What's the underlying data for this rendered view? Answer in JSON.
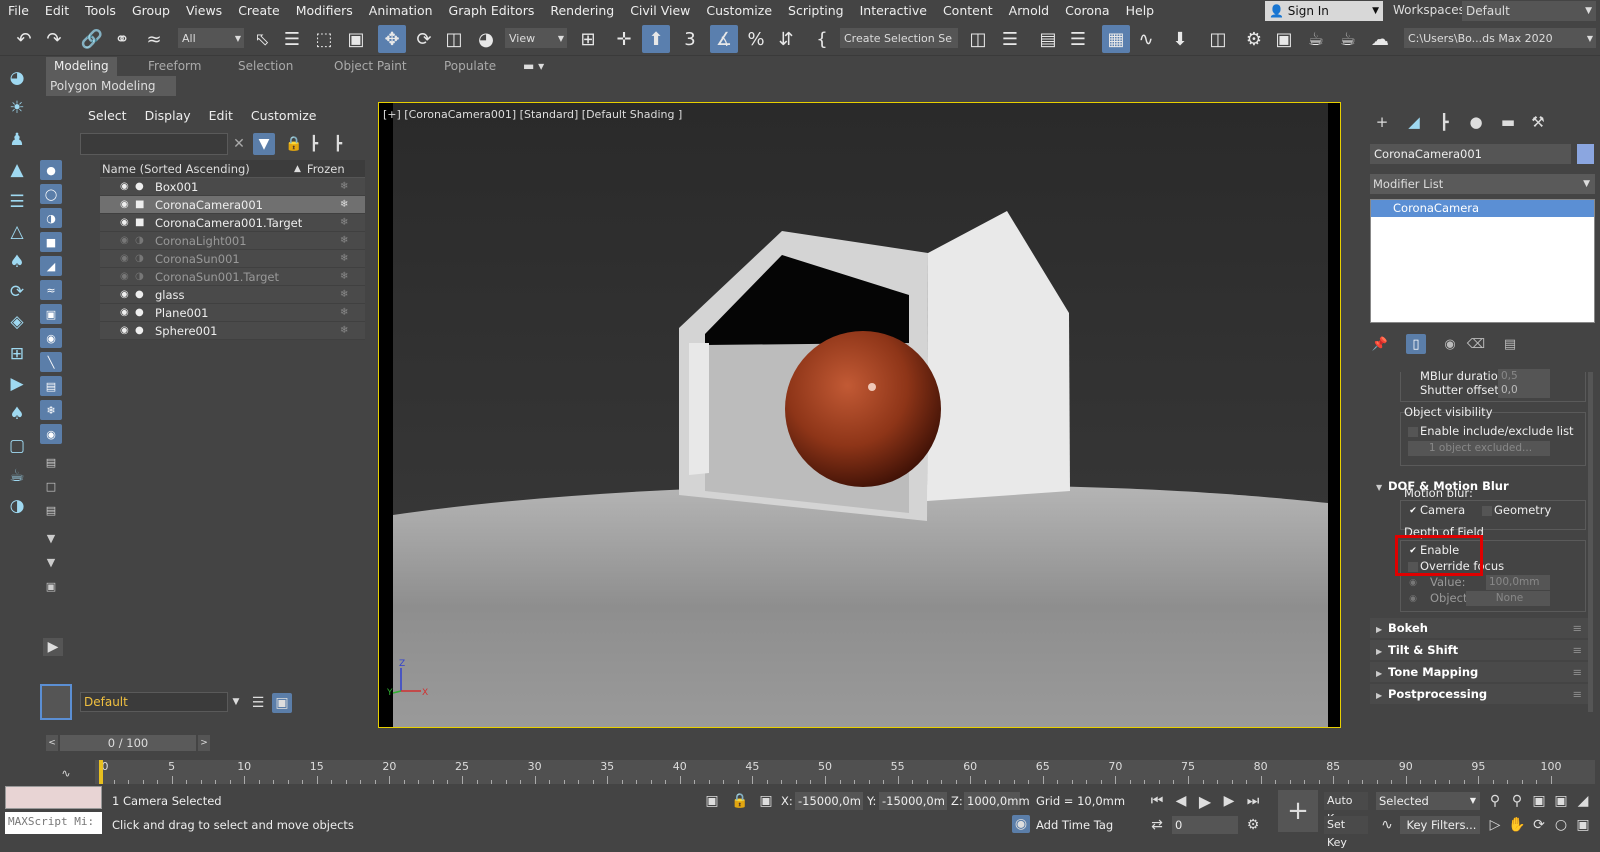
{
  "menubar": {
    "items": [
      "File",
      "Edit",
      "Tools",
      "Group",
      "Views",
      "Create",
      "Modifiers",
      "Animation",
      "Graph Editors",
      "Rendering",
      "Civil View",
      "Customize",
      "Scripting",
      "Interactive",
      "Content",
      "Arnold",
      "Corona",
      "Help"
    ],
    "signin": "Sign In",
    "workspaces_label": "Workspaces:",
    "workspace": "Default"
  },
  "toolbar": {
    "filter": "All",
    "ref_coord": "View",
    "selection_set": "Create Selection Se",
    "project_path": "C:\\Users\\Bo...ds Max 2020"
  },
  "ribbon": {
    "tabs": [
      "Modeling",
      "Freeform",
      "Selection",
      "Object Paint",
      "Populate"
    ],
    "subtab": "Polygon Modeling"
  },
  "scene_explorer": {
    "menu": [
      "Select",
      "Display",
      "Edit",
      "Customize"
    ],
    "col_name": "Name (Sorted Ascending)",
    "col_frozen": "Frozen",
    "rows": [
      {
        "name": "Box001"
      },
      {
        "name": "CoronaCamera001"
      },
      {
        "name": "CoronaCamera001.Target"
      },
      {
        "name": "CoronaLight001"
      },
      {
        "name": "CoronaSun001"
      },
      {
        "name": "CoronaSun001.Target"
      },
      {
        "name": "glass"
      },
      {
        "name": "Plane001"
      },
      {
        "name": "Sphere001"
      }
    ],
    "layer": "Default"
  },
  "viewport": {
    "label": "[+] [CoronaCamera001] [Standard] [Default Shading ]",
    "axis_z": "Z",
    "axis_y": "Y",
    "axis_x": "X"
  },
  "command_panel": {
    "object_name": "CoronaCamera001",
    "object_color": "#8ba6e0",
    "modifier_list": "Modifier List",
    "stack_item": "CoronaCamera",
    "mblur_duration_label": "MBlur duration:",
    "mblur_duration": "0,5",
    "shutter_offset_label": "Shutter offset:",
    "shutter_offset": "0,0",
    "object_visibility": "Object visibility",
    "enable_include_exclude": "Enable include/exclude list",
    "objects_excluded": "1 object excluded...",
    "dof_motion_blur": "DOF & Motion Blur",
    "motion_blur": "Motion blur:",
    "camera": "Camera",
    "geometry": "Geometry",
    "depth_of_field": "Depth of Field",
    "enable": "Enable",
    "override_focus": "Override focus",
    "value_label": "Value:",
    "value": "100,0mm",
    "object_label": "Object:",
    "object_value": "None",
    "rollouts": [
      "Bokeh",
      "Tilt & Shift",
      "Tone Mapping",
      "Postprocessing"
    ]
  },
  "timeline": {
    "slider": "0 / 100",
    "labels": [
      "0",
      "5",
      "10",
      "15",
      "20",
      "25",
      "30",
      "35",
      "40",
      "45",
      "50",
      "55",
      "60",
      "65",
      "70",
      "75",
      "80",
      "85",
      "90",
      "95",
      "100"
    ]
  },
  "status": {
    "selected": "1 Camera Selected",
    "prompt": "Click and drag to select and move objects",
    "maxscript": "MAXScript Mi:",
    "x_label": "X:",
    "x": "-15000,0m",
    "y_label": "Y:",
    "y": "-15000,0m",
    "z_label": "Z:",
    "z": "1000,0mm",
    "grid": "Grid = 10,0mm",
    "add_time_tag": "Add Time Tag",
    "frame": "0",
    "auto_key": "Auto Key",
    "set_key": "Set Key",
    "selected_set": "Selected",
    "key_filters": "Key Filters..."
  }
}
